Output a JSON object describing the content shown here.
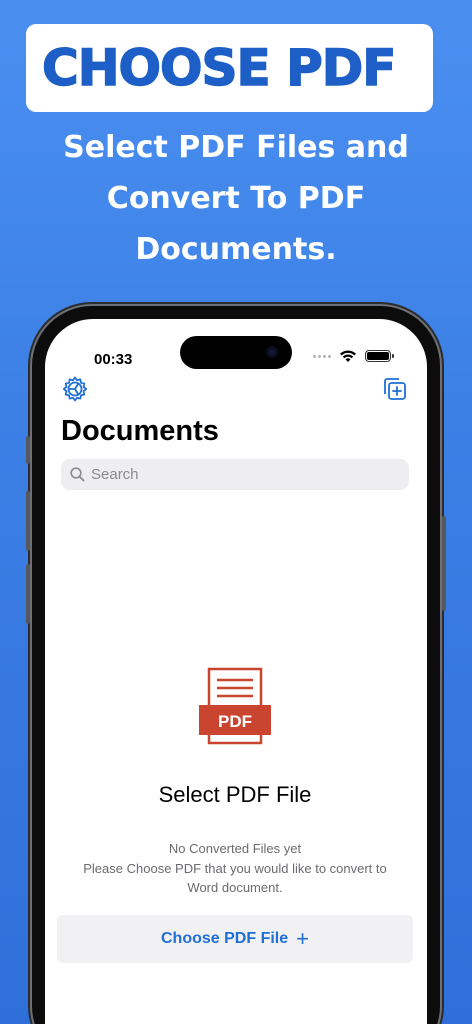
{
  "banner": {
    "title": "CHOOSE PDF"
  },
  "subtitle": {
    "lines": [
      "Select PDF Files and",
      "Convert To PDF",
      "Documents."
    ]
  },
  "status_bar": {
    "time": "00:33"
  },
  "page": {
    "title": "Documents"
  },
  "search": {
    "placeholder": "Search",
    "value": ""
  },
  "empty_state": {
    "pdf_icon_label": "PDF",
    "title": "Select PDF File",
    "hint_lines": [
      "No Converted Files yet",
      "Please Choose PDF that you would like to convert to",
      "Word document."
    ]
  },
  "actions": {
    "choose_label": "Choose PDF File",
    "choose_icon": "plus-icon"
  },
  "icons": {
    "settings": "settings-icon",
    "add": "add-document-icon",
    "search": "search-icon"
  },
  "colors": {
    "accent": "#1f6fd6",
    "pdf_red": "#c9452f",
    "background": "#3c80e6",
    "banner_text": "#1d5fc6"
  }
}
